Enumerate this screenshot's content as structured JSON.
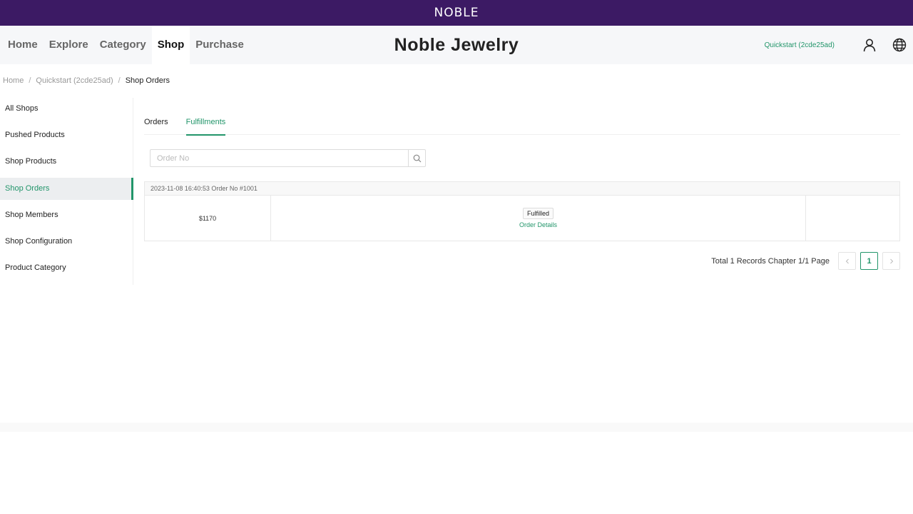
{
  "brand": {
    "logo_text": "NOBLE"
  },
  "navbar": {
    "items": [
      {
        "label": "Home",
        "active": false
      },
      {
        "label": "Explore",
        "active": false
      },
      {
        "label": "Category",
        "active": false
      },
      {
        "label": "Shop",
        "active": true
      },
      {
        "label": "Purchase",
        "active": false
      }
    ],
    "site_title": "Noble Jewelry",
    "shop_link": "Quickstart (2cde25ad)",
    "icons": [
      "user-icon",
      "globe-icon"
    ]
  },
  "breadcrumb": {
    "items": [
      "Home",
      "Quickstart (2cde25ad)",
      "Shop Orders"
    ],
    "separator": "/"
  },
  "sidebar": {
    "items": [
      {
        "label": "All Shops",
        "active": false
      },
      {
        "label": "Pushed Products",
        "active": false
      },
      {
        "label": "Shop Products",
        "active": false
      },
      {
        "label": "Shop Orders",
        "active": true
      },
      {
        "label": "Shop Members",
        "active": false
      },
      {
        "label": "Shop Configuration",
        "active": false
      },
      {
        "label": "Product Category",
        "active": false
      }
    ]
  },
  "main": {
    "tabs": [
      {
        "label": "Orders",
        "active": false
      },
      {
        "label": "Fulfillments",
        "active": true
      }
    ],
    "search": {
      "placeholder": "Order No",
      "value": ""
    },
    "orders": [
      {
        "header": "2023-11-08 16:40:53 Order No #1001",
        "amount": "$1170",
        "status": "Fulfilled",
        "details_link": "Order Details"
      }
    ],
    "pagination": {
      "summary": "Total 1 Records Chapter 1/1 Page",
      "prev": "<",
      "current_page": "1",
      "next": ">"
    }
  },
  "colors": {
    "topbar": "#3c1a64",
    "accent": "#22956a",
    "navbar_bg": "#f6f7f9"
  }
}
